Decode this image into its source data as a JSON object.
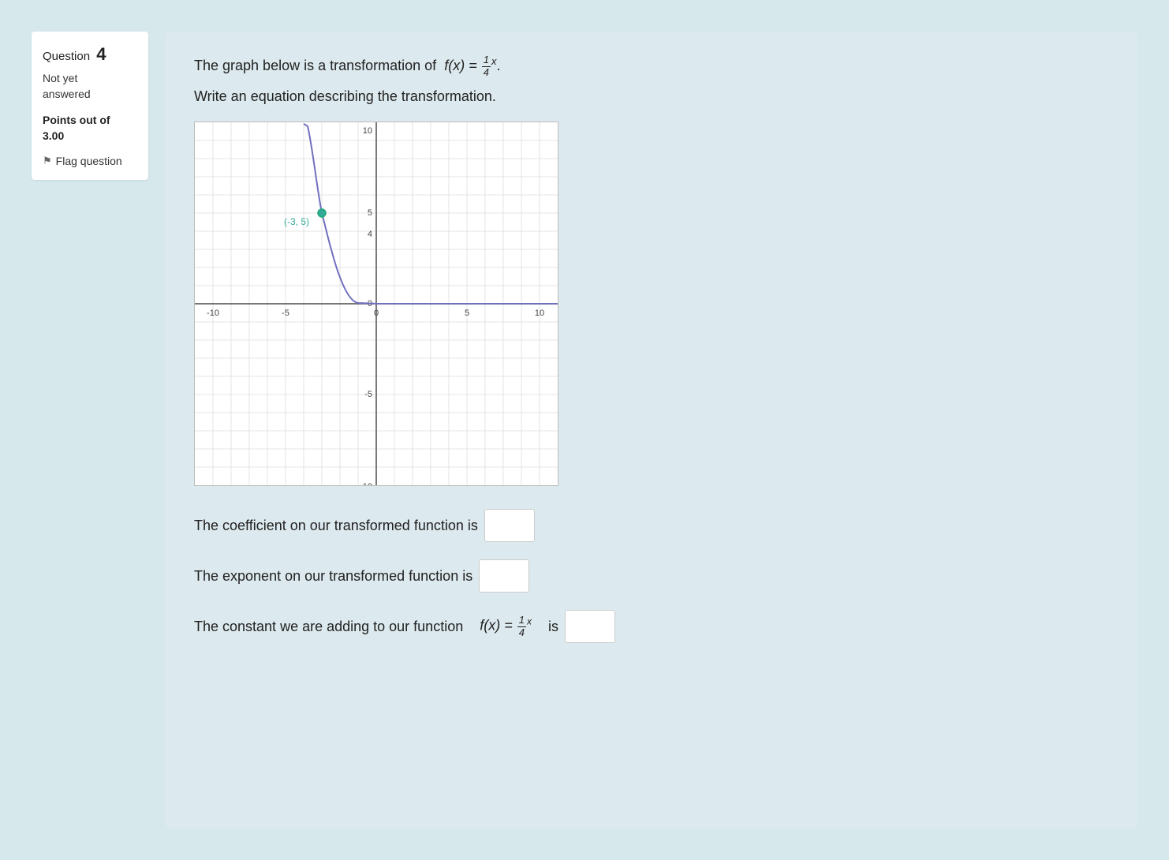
{
  "sidebar": {
    "question_label": "Question",
    "question_number": "4",
    "status_line1": "Not yet",
    "status_line2": "answered",
    "points_label": "Points out of",
    "points_value": "3.00",
    "flag_label": "Flag question"
  },
  "main": {
    "line1": "The graph below is a transformation of",
    "line1_func": "f(x) = (1/4)^x",
    "line2": "Write an equation describing the transformation.",
    "graph": {
      "point_label": "(-3, 5)",
      "x_min": -10,
      "x_max": 10,
      "y_min": -10,
      "y_max": 10
    },
    "q1_prefix": "The coefficient on our transformed function is",
    "q2_prefix": "The exponent on our transformed function is",
    "q3_prefix": "The constant we are adding to our function",
    "q3_func": "f(x) = (1/4)^x",
    "q3_suffix": "is"
  },
  "inputs": {
    "coefficient_value": "",
    "exponent_value": "",
    "constant_value": ""
  }
}
